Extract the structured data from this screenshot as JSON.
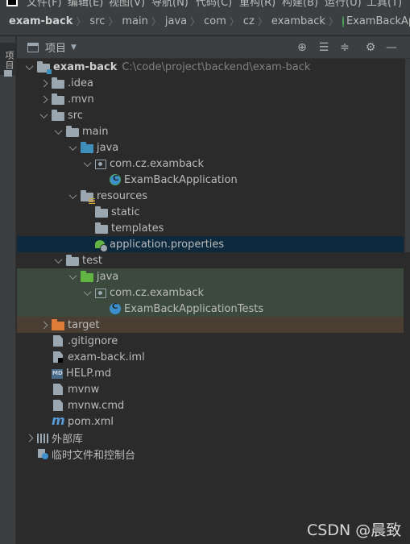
{
  "menubar": {
    "items": [
      "文件(F)",
      "编辑(E)",
      "视图(V)",
      "导航(N)",
      "代码(C)",
      "重构(R)",
      "构建(B)",
      "运行(U)",
      "工具(T)"
    ]
  },
  "breadcrumb": [
    "exam-back",
    "src",
    "main",
    "java",
    "com",
    "cz",
    "examback",
    "ExamBackApplication"
  ],
  "toolstrip": {
    "project_tab": "项目"
  },
  "panel": {
    "title": "项目",
    "buttons": [
      "crosshair-icon",
      "expand-all-icon",
      "collapse-all-icon",
      "gear-icon",
      "minimize-icon"
    ]
  },
  "tree": [
    {
      "label": "exam-back",
      "path": "C:\\code\\project\\backend\\exam-back",
      "icon": "module-folder-icon",
      "depth": 0,
      "expanded": true
    },
    {
      "label": ".idea",
      "icon": "folder-icon",
      "depth": 1,
      "expanded": false
    },
    {
      "label": ".mvn",
      "icon": "folder-icon",
      "depth": 1,
      "expanded": false
    },
    {
      "label": "src",
      "icon": "folder-icon",
      "depth": 1,
      "expanded": true
    },
    {
      "label": "main",
      "icon": "folder-icon",
      "depth": 2,
      "expanded": true
    },
    {
      "label": "java",
      "icon": "source-folder-icon",
      "depth": 3,
      "expanded": true
    },
    {
      "label": "com.cz.examback",
      "icon": "package-icon",
      "depth": 4,
      "expanded": true
    },
    {
      "label": "ExamBackApplication",
      "icon": "spring-boot-class-icon",
      "depth": 5
    },
    {
      "label": "resources",
      "icon": "resources-folder-icon",
      "depth": 3,
      "expanded": true
    },
    {
      "label": "static",
      "icon": "folder-icon",
      "depth": 4
    },
    {
      "label": "templates",
      "icon": "folder-icon",
      "depth": 4
    },
    {
      "label": "application.properties",
      "icon": "spring-properties-icon",
      "depth": 4,
      "selected": true
    },
    {
      "label": "test",
      "icon": "folder-icon",
      "depth": 2,
      "expanded": true
    },
    {
      "label": "java",
      "icon": "test-folder-icon",
      "depth": 3,
      "expanded": true
    },
    {
      "label": "com.cz.examback",
      "icon": "package-icon",
      "depth": 4,
      "expanded": true
    },
    {
      "label": "ExamBackApplicationTests",
      "icon": "class-icon",
      "depth": 5
    },
    {
      "label": "target",
      "icon": "excluded-folder-icon",
      "depth": 1,
      "expanded": false
    },
    {
      "label": ".gitignore",
      "icon": "gitignore-file-icon",
      "depth": 1
    },
    {
      "label": "exam-back.iml",
      "icon": "iml-file-icon",
      "depth": 1
    },
    {
      "label": "HELP.md",
      "icon": "markdown-file-icon",
      "depth": 1
    },
    {
      "label": "mvnw",
      "icon": "text-file-icon",
      "depth": 1
    },
    {
      "label": "mvnw.cmd",
      "icon": "text-file-icon",
      "depth": 1
    },
    {
      "label": "pom.xml",
      "icon": "maven-icon",
      "depth": 1
    },
    {
      "label": "外部库",
      "icon": "libraries-icon",
      "depth": 0,
      "expanded": false
    },
    {
      "label": "临时文件和控制台",
      "icon": "scratches-icon",
      "depth": 0
    }
  ],
  "watermark": "CSDN @晨致",
  "colors": {
    "background": "#2b2b2b",
    "panel": "#3c3f41",
    "selected_row": "#0d293e",
    "test_rows": "#3b4a3c",
    "excluded_row": "#4a3d32",
    "accent_blue": "#3d8fcc"
  }
}
